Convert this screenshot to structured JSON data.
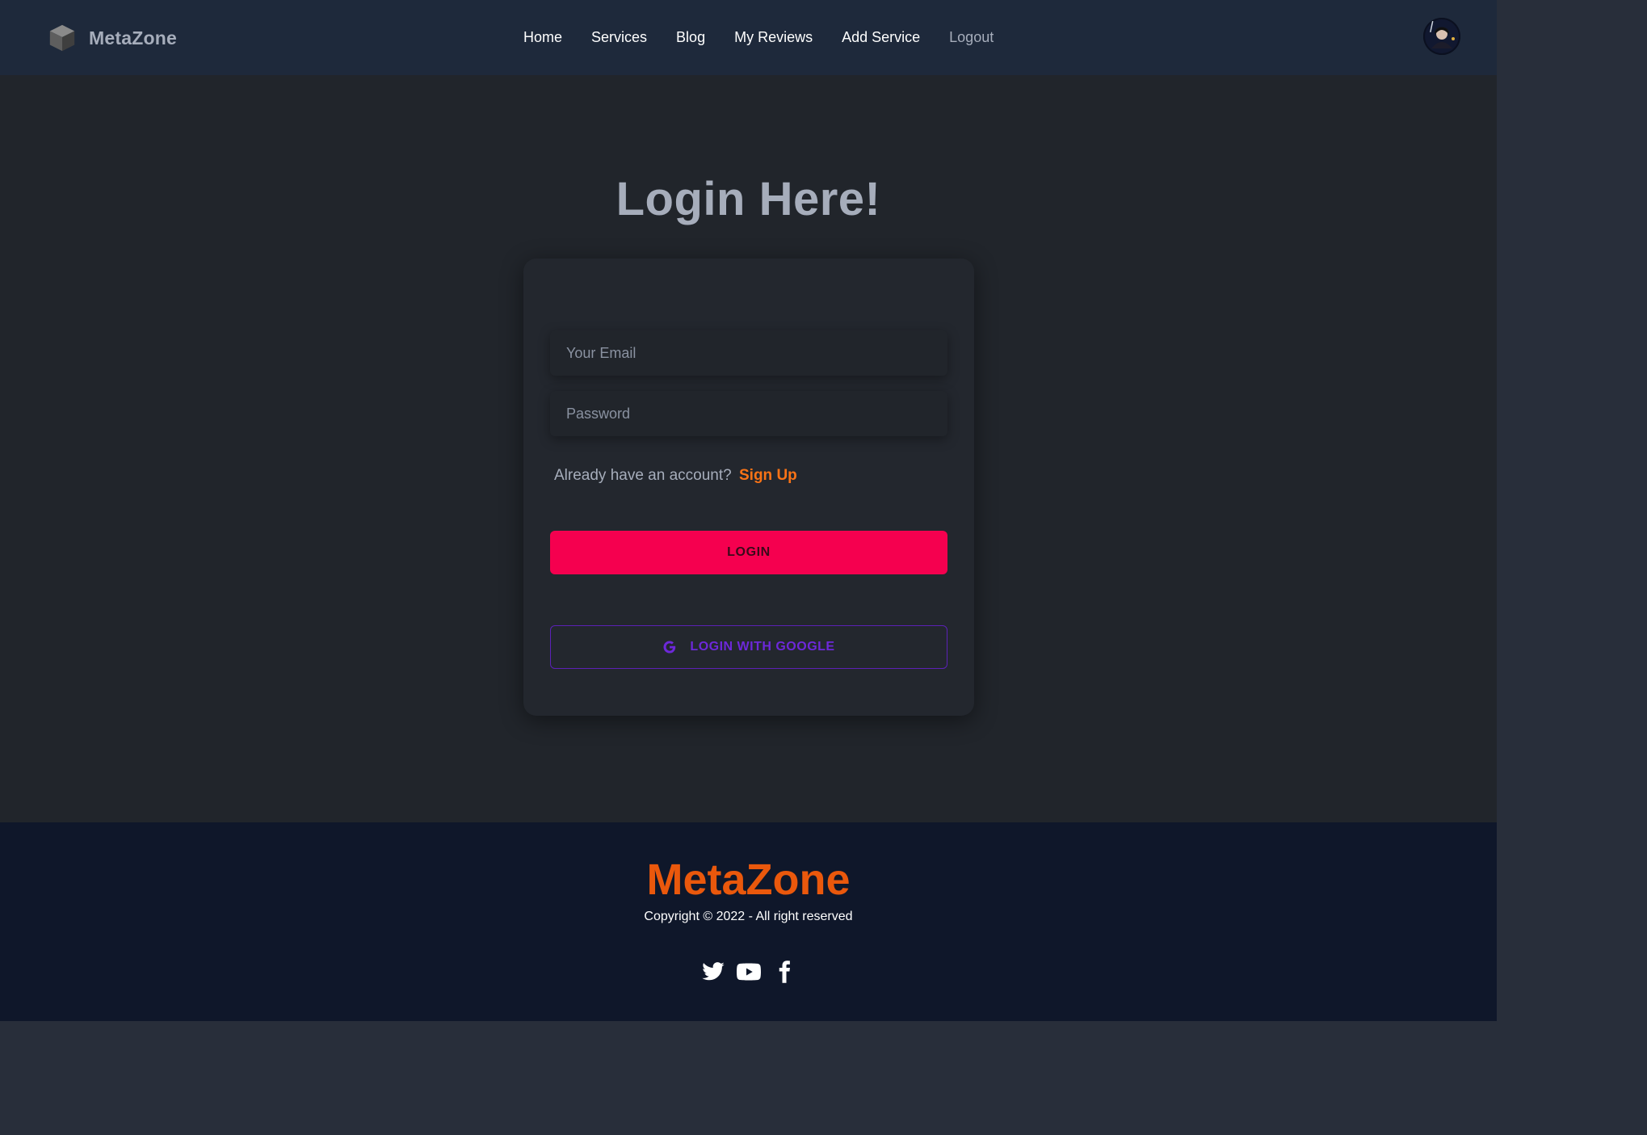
{
  "nav": {
    "brand": "MetaZone",
    "items": [
      {
        "label": "Home"
      },
      {
        "label": "Services"
      },
      {
        "label": "Blog"
      },
      {
        "label": "My Reviews"
      },
      {
        "label": "Add Service"
      },
      {
        "label": "Logout"
      }
    ]
  },
  "login": {
    "title": "Login Here!",
    "email_placeholder": "Your Email",
    "password_placeholder": "Password",
    "account_prompt": "Already have an account?",
    "signup_label": "Sign Up",
    "login_label": "LOGIN",
    "google_label": "LOGIN WITH GOOGLE"
  },
  "footer": {
    "brand": "MetaZone",
    "copyright": "Copyright © 2022 - All right reserved",
    "socials": [
      "twitter-icon",
      "youtube-icon",
      "facebook-icon"
    ]
  },
  "colors": {
    "navbar_bg": "#1e293b",
    "main_bg": "#21252b",
    "footer_bg": "#0f172a",
    "login_button": "#f5004f",
    "google_border": "#5b21b6",
    "signup_link": "#f97316",
    "footer_brand": "#ea580c"
  }
}
